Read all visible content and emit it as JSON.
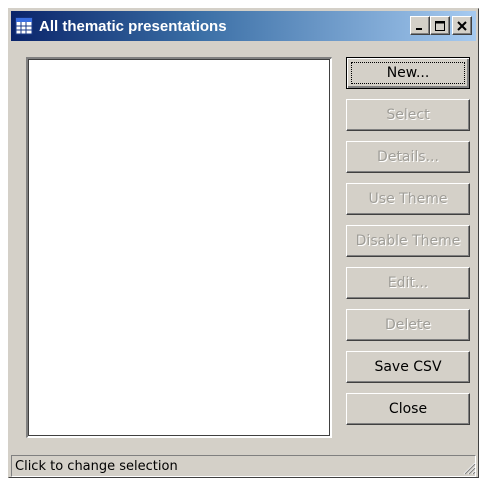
{
  "window": {
    "title": "All thematic presentations",
    "controls": {
      "minimize": "_",
      "maximize": "□",
      "close": "✕"
    }
  },
  "list": {
    "items": []
  },
  "buttons": [
    {
      "name": "new-button",
      "label": "New...",
      "enabled": true,
      "default": true
    },
    {
      "name": "select-button",
      "label": "Select",
      "enabled": false
    },
    {
      "name": "details-button",
      "label": "Details...",
      "enabled": false
    },
    {
      "name": "use-theme-button",
      "label": "Use Theme",
      "enabled": false
    },
    {
      "name": "disable-theme-button",
      "label": "Disable Theme",
      "enabled": false
    },
    {
      "name": "edit-button",
      "label": "Edit...",
      "enabled": false
    },
    {
      "name": "delete-button",
      "label": "Delete",
      "enabled": false
    },
    {
      "name": "save-csv-button",
      "label": "Save CSV",
      "enabled": true
    },
    {
      "name": "close-button",
      "label": "Close",
      "enabled": true
    }
  ],
  "status": {
    "text": "Click to change selection"
  },
  "icons": {
    "app": "table-icon",
    "grip": "resize-grip-icon"
  }
}
